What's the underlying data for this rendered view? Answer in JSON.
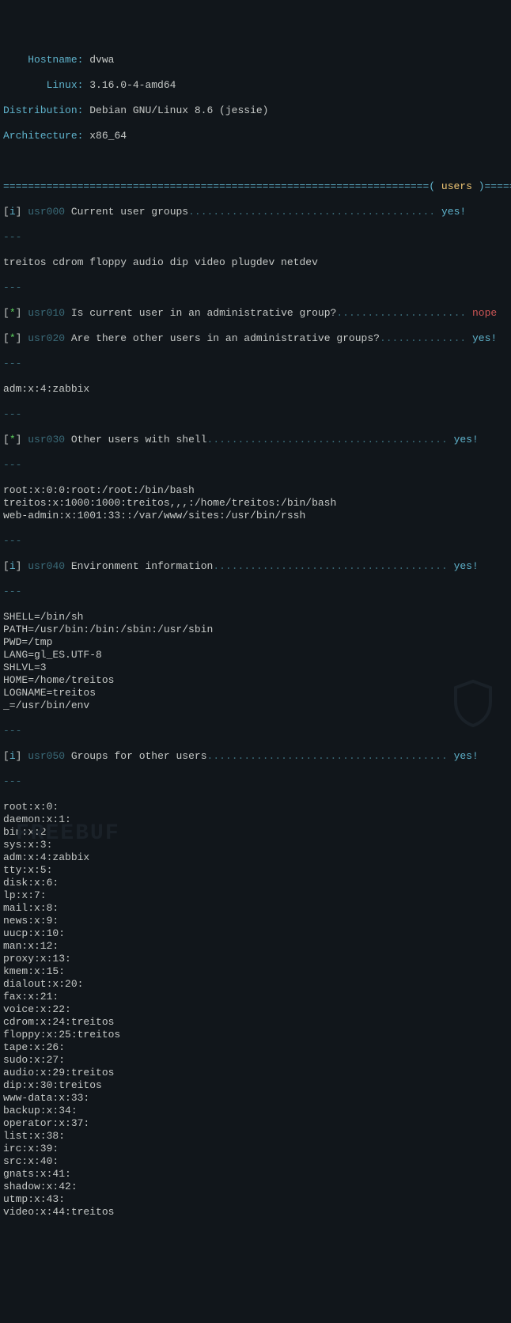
{
  "sysinfo": {
    "hostname_label": "Hostname:",
    "hostname": "dvwa",
    "linux_label": "Linux:",
    "linux": "3.16.0-4-amd64",
    "distribution_label": "Distribution:",
    "distribution": "Debian GNU/Linux 8.6 (jessie)",
    "architecture_label": "Architecture:",
    "architecture": "x86_64"
  },
  "section": {
    "bar_left": "=====================================================================( ",
    "title": "users",
    "bar_right": " )=====",
    "dashes": "---"
  },
  "checks": {
    "usr000": {
      "code": "usr000",
      "mark": "i",
      "title": "Current user groups",
      "dots": "........................................ ",
      "result": "yes!"
    },
    "usr010": {
      "code": "usr010",
      "mark": "*",
      "title": "Is current user in an administrative group?",
      "dots": "..................... ",
      "result": "nope"
    },
    "usr020": {
      "code": "usr020",
      "mark": "*",
      "title": "Are there other users in an administrative groups?",
      "dots": ".............. ",
      "result": "yes!"
    },
    "usr030": {
      "code": "usr030",
      "mark": "*",
      "title": "Other users with shell",
      "dots": "....................................... ",
      "result": "yes!"
    },
    "usr040": {
      "code": "usr040",
      "mark": "i",
      "title": "Environment information",
      "dots": "...................................... ",
      "result": "yes!"
    },
    "usr050": {
      "code": "usr050",
      "mark": "i",
      "title": "Groups for other users",
      "dots": "....................................... ",
      "result": "yes!"
    }
  },
  "blocks": {
    "usr000_body": "treitos cdrom floppy audio dip video plugdev netdev",
    "usr020_body": "adm:x:4:zabbix",
    "usr030_body": "root:x:0:0:root:/root:/bin/bash\ntreitos:x:1000:1000:treitos,,,:/home/treitos:/bin/bash\nweb-admin:x:1001:33::/var/www/sites:/usr/bin/rssh",
    "usr040_body": "SHELL=/bin/sh\nPATH=/usr/bin:/bin:/sbin:/usr/sbin\nPWD=/tmp\nLANG=gl_ES.UTF-8\nSHLVL=3\nHOME=/home/treitos\nLOGNAME=treitos\n_=/usr/bin/env",
    "usr050_body": "root:x:0:\ndaemon:x:1:\nbin:x:2:\nsys:x:3:\nadm:x:4:zabbix\ntty:x:5:\ndisk:x:6:\nlp:x:7:\nmail:x:8:\nnews:x:9:\nuucp:x:10:\nman:x:12:\nproxy:x:13:\nkmem:x:15:\ndialout:x:20:\nfax:x:21:\nvoice:x:22:\ncdrom:x:24:treitos\nfloppy:x:25:treitos\ntape:x:26:\nsudo:x:27:\naudio:x:29:treitos\ndip:x:30:treitos\nwww-data:x:33:\nbackup:x:34:\noperator:x:37:\nlist:x:38:\nirc:x:39:\nsrc:x:40:\ngnats:x:41:\nshadow:x:42:\nutmp:x:43:\nvideo:x:44:treitos"
  },
  "watermark": "FREEBUF"
}
